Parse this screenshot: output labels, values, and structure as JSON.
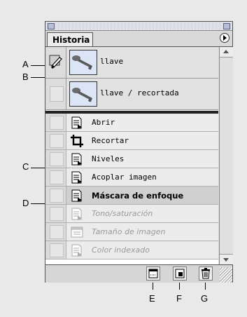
{
  "palette": {
    "tab_label": "Historia",
    "snapshots": [
      {
        "label": "llave",
        "icon": "key-thumbnail"
      },
      {
        "label": "llave / recortada",
        "icon": "key-thumbnail"
      }
    ],
    "states": [
      {
        "label": "Abrir",
        "icon": "document-icon",
        "status": "normal"
      },
      {
        "label": "Recortar",
        "icon": "crop-icon",
        "status": "normal"
      },
      {
        "label": "Niveles",
        "icon": "document-icon",
        "status": "normal"
      },
      {
        "label": "Acoplar imagen",
        "icon": "document-icon",
        "status": "normal"
      },
      {
        "label": "Máscara de enfoque",
        "icon": "document-icon",
        "status": "current"
      },
      {
        "label": "Tono/saturación",
        "icon": "document-icon",
        "status": "undone"
      },
      {
        "label": "Tamaño de imagen",
        "icon": "image-size-icon",
        "status": "undone"
      },
      {
        "label": "Color indexado",
        "icon": "document-icon",
        "status": "undone"
      }
    ],
    "bottom_buttons": [
      {
        "name": "new-document-from-state-button",
        "icon": "new-document-icon"
      },
      {
        "name": "new-snapshot-button",
        "icon": "new-snapshot-icon"
      },
      {
        "name": "delete-state-button",
        "icon": "trash-icon"
      }
    ]
  },
  "callouts": {
    "a": "A",
    "b": "B",
    "c": "C",
    "d": "D",
    "e": "E",
    "f": "F",
    "g": "G"
  }
}
